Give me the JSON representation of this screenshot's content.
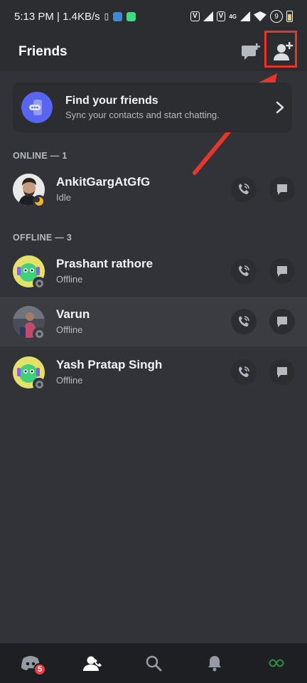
{
  "status_bar": {
    "time_speed": "5:13 PM | 1.4KB/s",
    "sim1": "V",
    "sim2": "V",
    "network": "4G",
    "battery_level": "9"
  },
  "header": {
    "title": "Friends",
    "new_message_icon": "new-message-icon",
    "add_friend_icon": "add-friend-icon"
  },
  "find_friends": {
    "title": "Find your friends",
    "subtitle": "Sync your contacts and start chatting."
  },
  "sections": {
    "online_label": "ONLINE — 1",
    "offline_label": "OFFLINE — 3"
  },
  "friends": [
    {
      "name": "AnkitGargAtGfG",
      "status": "Idle"
    },
    {
      "name": "Prashant rathore",
      "status": "Offline"
    },
    {
      "name": "Varun",
      "status": "Offline"
    },
    {
      "name": "Yash Pratap Singh",
      "status": "Offline"
    }
  ],
  "bottom_nav": {
    "badge_count": "5",
    "items": [
      "home-icon",
      "friends-icon",
      "search-icon",
      "notifications-icon",
      "profile-icon"
    ]
  },
  "colors": {
    "background": "#313338",
    "accent": "#5865f2",
    "highlight": "#e8352b",
    "idle": "#f0b232",
    "offline": "#80848e"
  }
}
